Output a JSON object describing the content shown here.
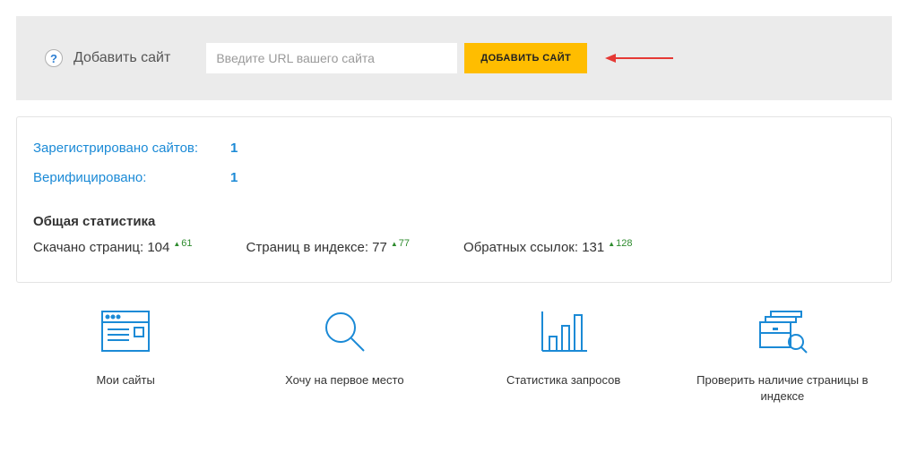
{
  "topPanel": {
    "helpGlyph": "?",
    "label": "Добавить сайт",
    "placeholder": "Введите URL вашего сайта",
    "button": "ДОБАВИТЬ САЙТ"
  },
  "stats": {
    "registered": {
      "label": "Зарегистрировано сайтов:",
      "value": "1"
    },
    "verified": {
      "label": "Верифицировано:",
      "value": "1"
    },
    "overallTitle": "Общая статистика",
    "downloaded": {
      "label": "Скачано страниц: ",
      "value": "104",
      "delta": "61"
    },
    "indexed": {
      "label": "Страниц в индексе: ",
      "value": "77",
      "delta": "77"
    },
    "backlinks": {
      "label": "Обратных ссылок: ",
      "value": "131",
      "delta": "128"
    }
  },
  "tiles": {
    "mySites": "Мои сайты",
    "firstPlace": "Хочу на первое место",
    "queryStats": "Статистика запросов",
    "checkIndex": "Проверить наличие страницы в индексе"
  }
}
